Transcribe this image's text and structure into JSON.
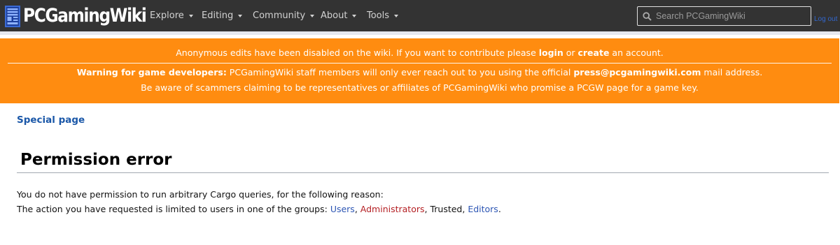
{
  "header": {
    "logo_text": "PCGamingWiki",
    "nav": [
      {
        "label": "Explore"
      },
      {
        "label": "Editing"
      },
      {
        "label": "Community"
      },
      {
        "label": "About"
      },
      {
        "label": "Tools"
      }
    ],
    "search_placeholder": "Search PCGamingWiki",
    "logout_label": "Log out"
  },
  "banner": {
    "line1_pre": "Anonymous edits have been disabled on the wiki. If you want to contribute please ",
    "login": "login",
    "or": " or ",
    "create": "create",
    "line1_post": " an account.",
    "warning_label": "Warning for game developers:",
    "warning_text": " PCGamingWiki staff members will only ever reach out to you using the official ",
    "email": "press@pcgamingwiki.com",
    "warning_end": " mail address.",
    "line3": "Be aware of scammers claiming to be representatives or affiliates of PCGamingWiki who promise a PCGW page for a game key."
  },
  "main": {
    "special_page": "Special page",
    "title": "Permission error",
    "line1": "You do not have permission to run arbitrary Cargo queries, for the following reason:",
    "line2_pre": "The action you have requested is limited to users in one of the groups: ",
    "groups": {
      "users": "Users",
      "sep1": ", ",
      "administrators": "Administrators",
      "sep2": ", Trusted, ",
      "editors": "Editors",
      "end": "."
    }
  },
  "colors": {
    "header_bg": "#333333",
    "banner_bg": "#ff8c10",
    "link_blue": "#2d56b4",
    "link_red": "#b41f23"
  },
  "icons": {
    "logo": "pcgw-logo-icon",
    "search": "search-icon",
    "caret": "caret-down-icon"
  }
}
